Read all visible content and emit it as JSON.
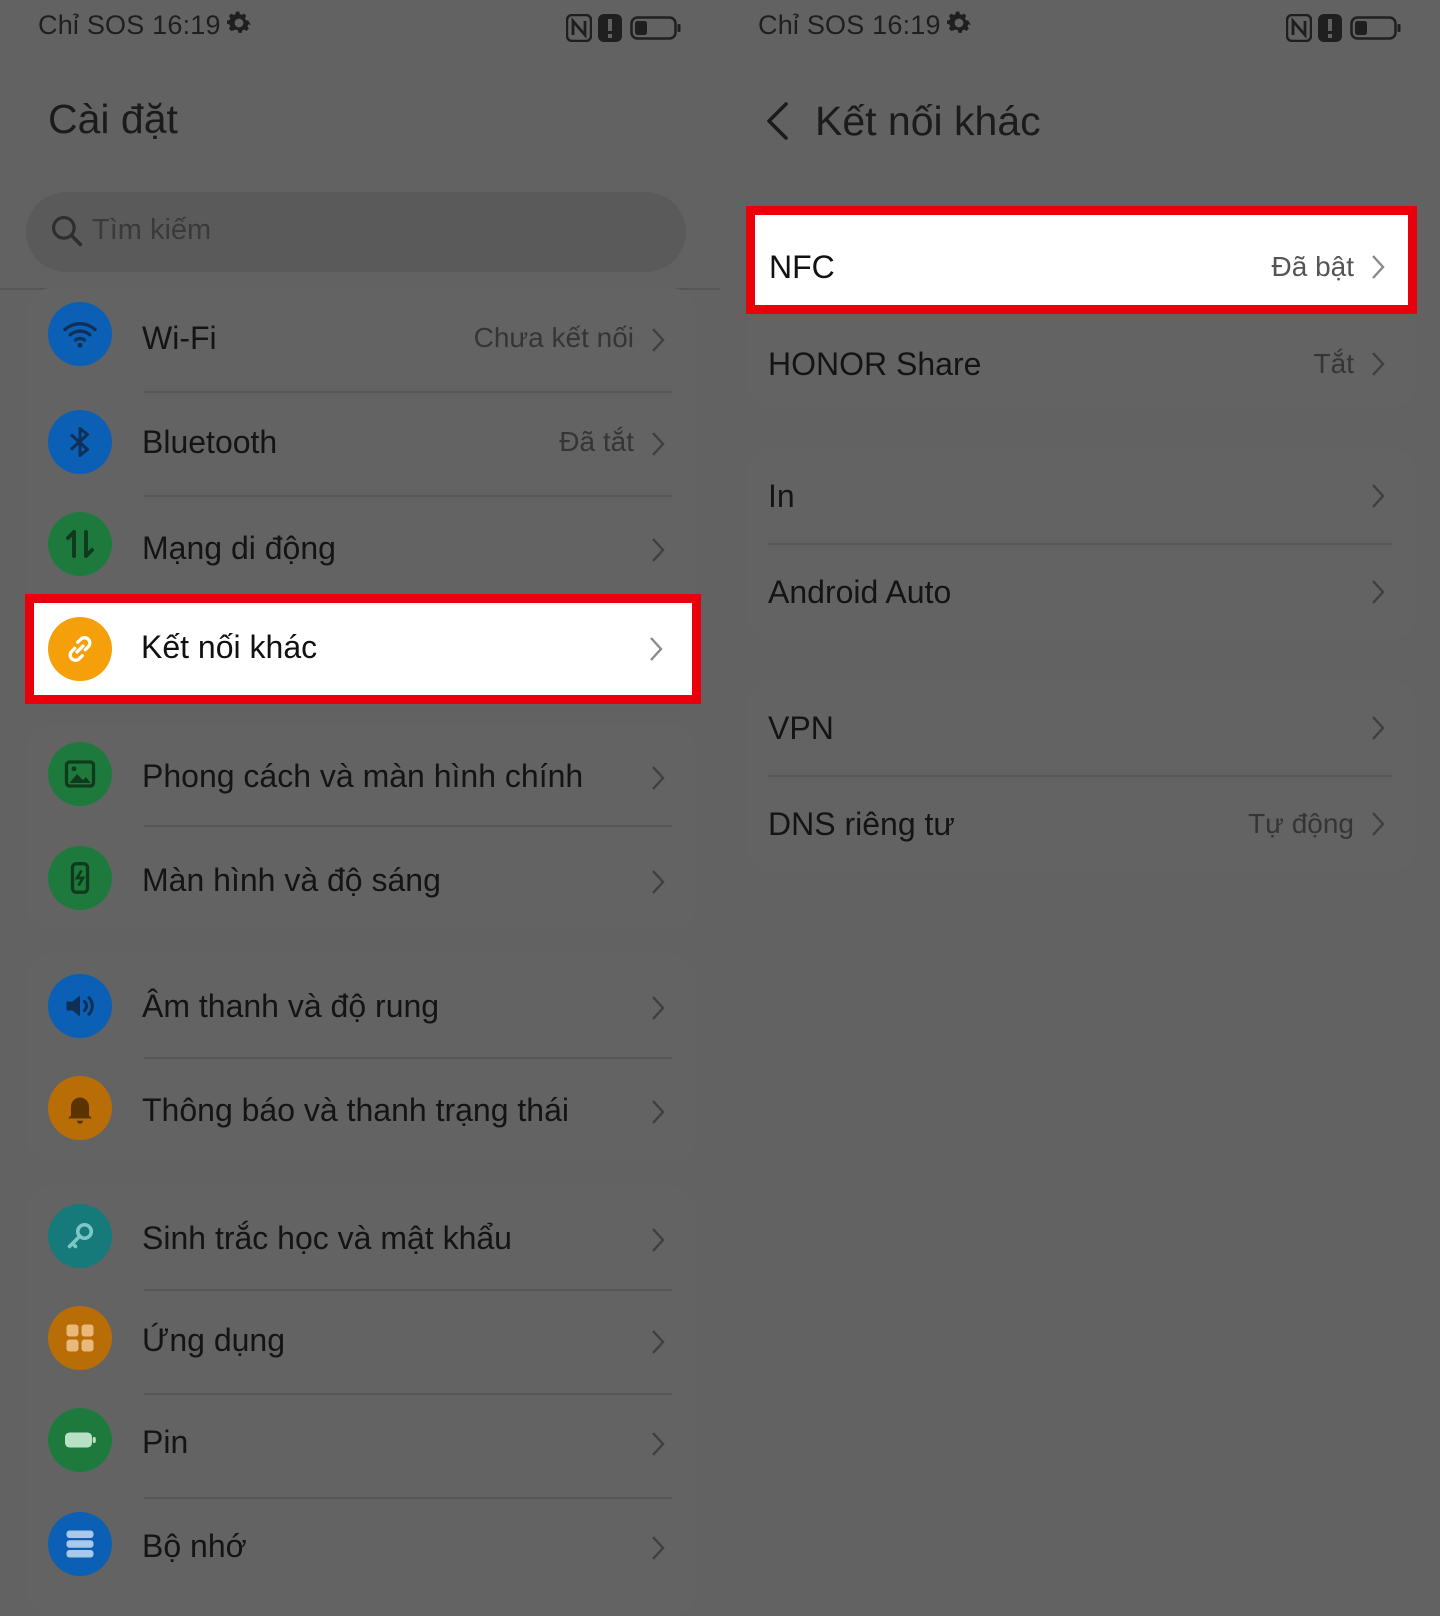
{
  "left": {
    "status": {
      "text": "Chỉ SOS 16:19"
    },
    "title": "Cài đặt",
    "search": {
      "placeholder": "Tìm kiếm"
    },
    "items": [
      {
        "label": "Wi-Fi",
        "value": "Chưa kết nối",
        "icon": "wifi-icon",
        "color": "#0b5fb4"
      },
      {
        "label": "Bluetooth",
        "value": "Đã tắt",
        "icon": "bluetooth-icon",
        "color": "#0b5fb4"
      },
      {
        "label": "Mạng di động",
        "value": "",
        "icon": "mobile-data-icon",
        "color": "#1e7a3c"
      },
      {
        "label": "Kết nối khác",
        "value": "",
        "icon": "link-icon",
        "color": "#f5a00a"
      },
      {
        "label": "Phong cách và màn hình chính",
        "value": "",
        "icon": "wallpaper-icon",
        "color": "#1e7a3c"
      },
      {
        "label": "Màn hình và độ sáng",
        "value": "",
        "icon": "display-icon",
        "color": "#1e7a3c"
      },
      {
        "label": "Âm thanh và độ rung",
        "value": "",
        "icon": "sound-icon",
        "color": "#0b5fb4"
      },
      {
        "label": "Thông báo và thanh trạng thái",
        "value": "",
        "icon": "bell-icon",
        "color": "#b96d07"
      },
      {
        "label": "Sinh trắc học và mật khẩu",
        "value": "",
        "icon": "key-icon",
        "color": "#157a79"
      },
      {
        "label": "Ứng dụng",
        "value": "",
        "icon": "apps-icon",
        "color": "#b96d07"
      },
      {
        "label": "Pin",
        "value": "",
        "icon": "battery-icon",
        "color": "#1e7a3c"
      },
      {
        "label": "Bộ nhớ",
        "value": "",
        "icon": "storage-icon",
        "color": "#0b5fb4"
      }
    ]
  },
  "right": {
    "status": {
      "text": "Chỉ SOS 16:19"
    },
    "title": "Kết nối khác",
    "items": [
      {
        "label": "NFC",
        "value": "Đã bật"
      },
      {
        "label": "HONOR Share",
        "value": "Tắt"
      },
      {
        "label": "In",
        "value": ""
      },
      {
        "label": "Android Auto",
        "value": ""
      },
      {
        "label": "VPN",
        "value": ""
      },
      {
        "label": "DNS riêng tư",
        "value": "Tự động"
      }
    ]
  },
  "colors": {
    "highlight": "#e9000a",
    "dim_background": "#626262"
  }
}
